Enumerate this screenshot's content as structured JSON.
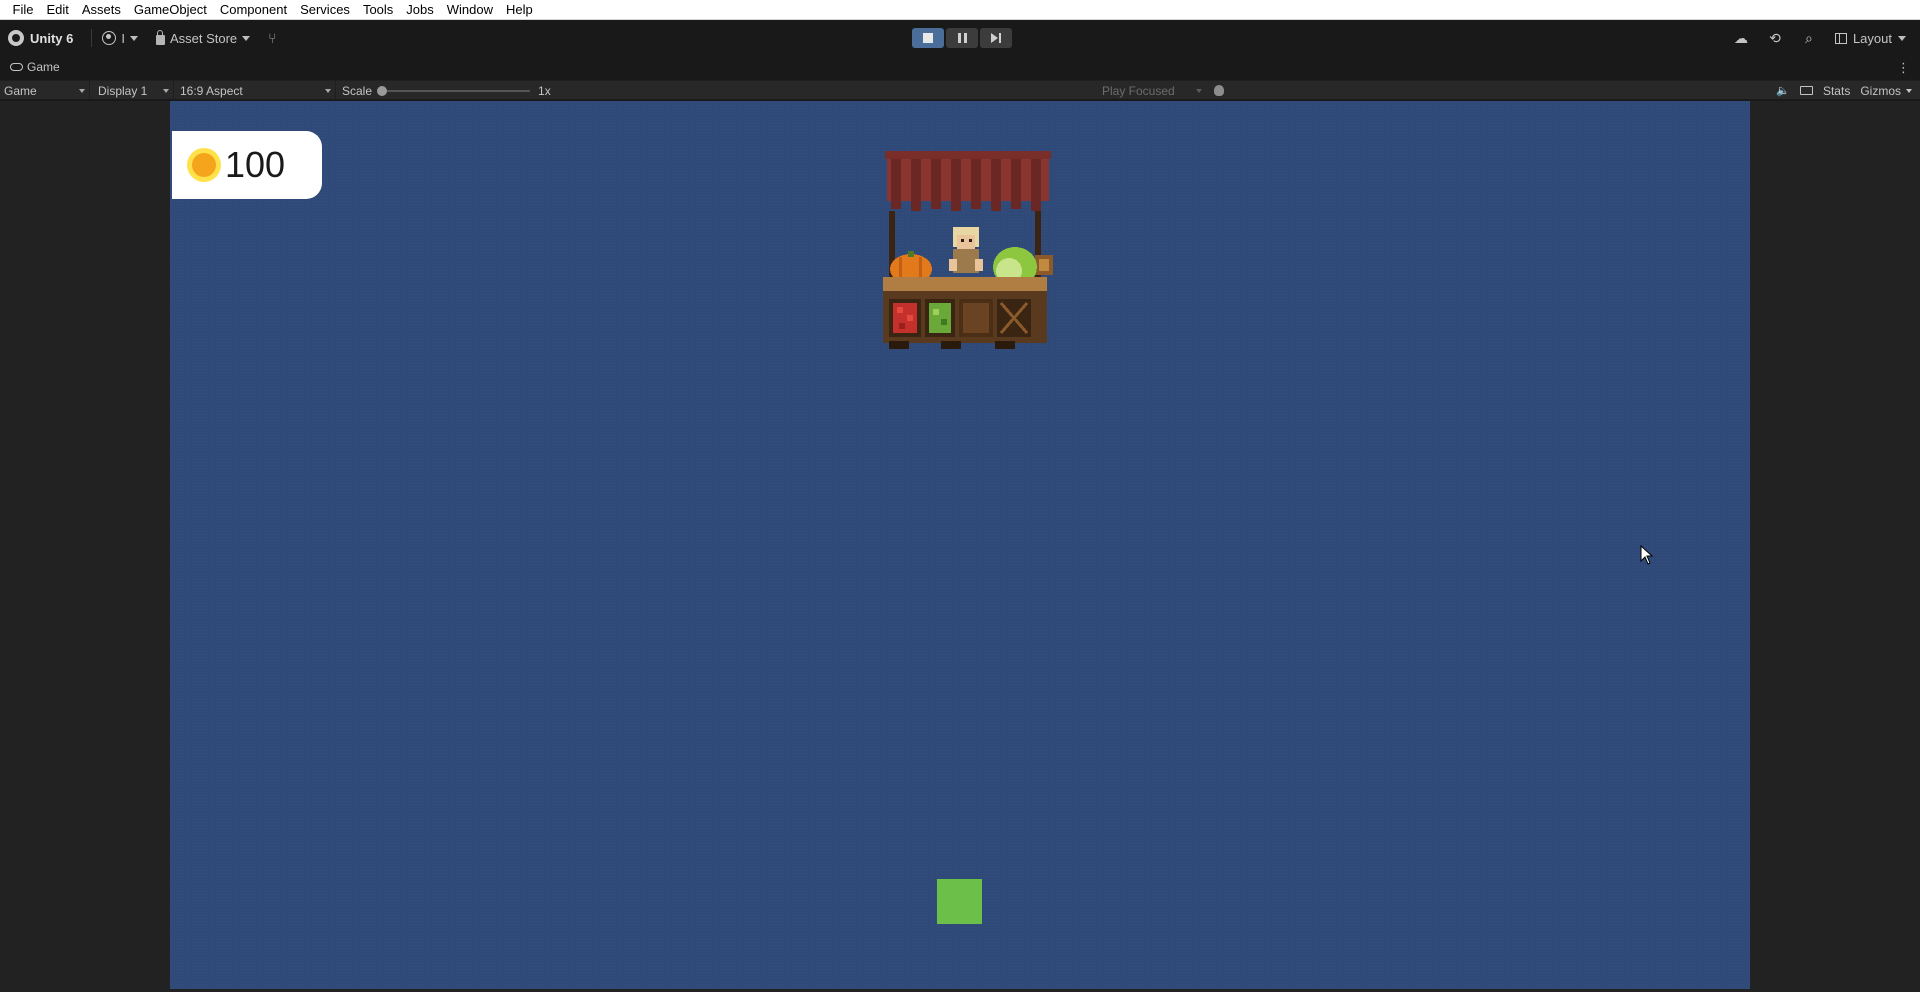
{
  "menu": [
    "File",
    "Edit",
    "Assets",
    "GameObject",
    "Component",
    "Services",
    "Tools",
    "Jobs",
    "Window",
    "Help"
  ],
  "toolbar": {
    "title": "Unity 6",
    "account_label": "I",
    "asset_store": "Asset Store",
    "layout": "Layout",
    "play_state": "playing"
  },
  "tab": {
    "label": "Game"
  },
  "game_toolbar": {
    "display_mode": "Game",
    "display": "Display 1",
    "aspect": "16:9 Aspect",
    "scale_label": "Scale",
    "scale_value": "1x",
    "play_mode": "Play Focused",
    "stats": "Stats",
    "gizmos": "Gizmos"
  },
  "hud": {
    "coins": "100"
  },
  "colors": {
    "game_background": "#2f4a78",
    "player": "#6cc04a",
    "coin_outer": "#ffe24a",
    "coin_inner": "#f4a51c",
    "play_active": "#4a6d9a"
  },
  "icons": {
    "unity": "unity-logo-icon",
    "account": "account-icon",
    "lock": "lock-icon",
    "vcs": "version-control-icon",
    "cloud": "cloud-icon",
    "history": "history-icon",
    "search": "search-icon",
    "layout": "layout-icon",
    "gamepad": "gamepad-icon",
    "bug": "bug-icon",
    "mute": "mute-audio-icon",
    "keyboard": "keyboard-shortcuts-icon"
  }
}
